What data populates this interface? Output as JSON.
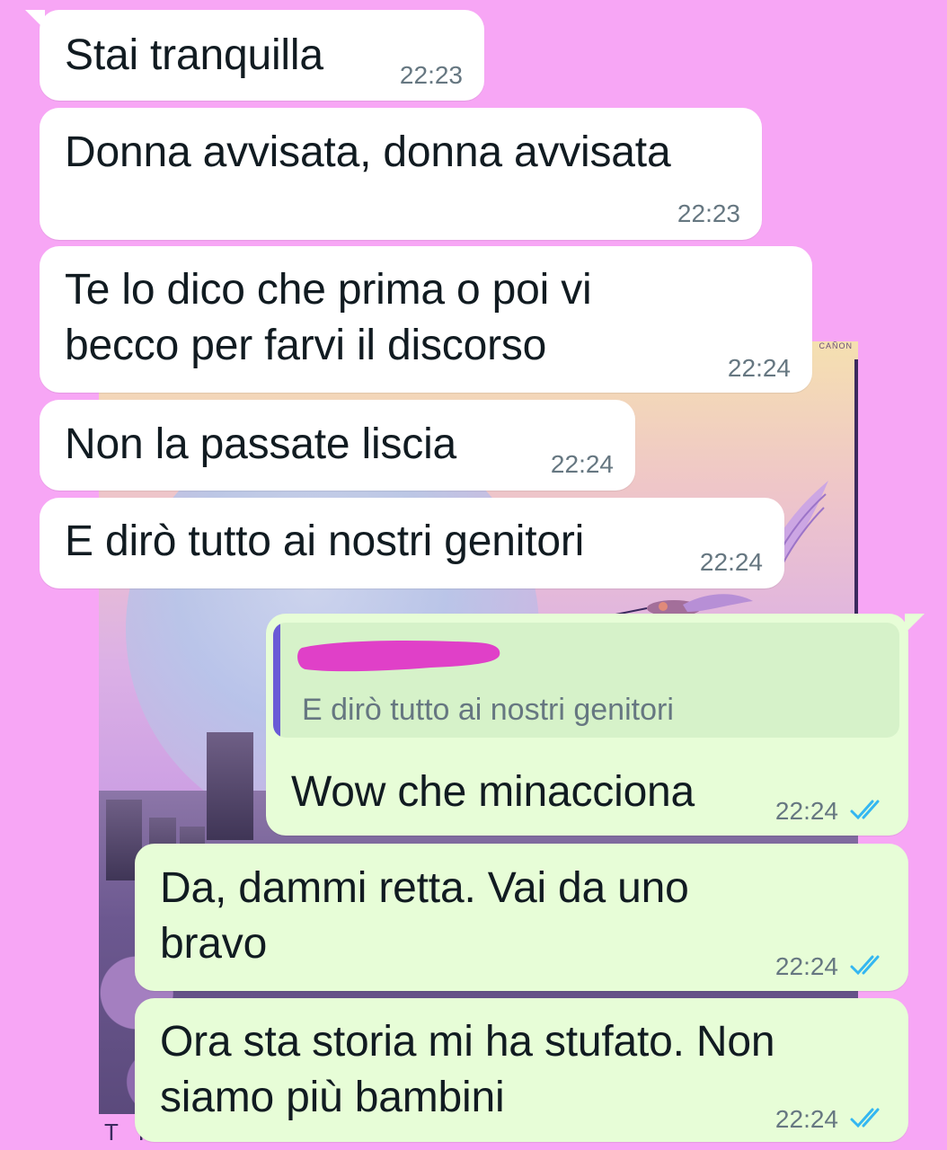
{
  "colors": {
    "background": "#f7a6f5",
    "incoming_bubble": "#ffffff",
    "outgoing_bubble": "#e7fdd7",
    "timestamp": "#667781",
    "read_ticks": "#34b7f1",
    "quote_bar": "#6a5ad6",
    "redaction": "#e040c8"
  },
  "wallpaper": {
    "brand": "CAÑON",
    "caption": "THE END OF THE PROMISED LANDS"
  },
  "messages": [
    {
      "direction": "incoming",
      "text": "Stai tranquilla",
      "time": "22:23"
    },
    {
      "direction": "incoming",
      "text": "Donna avvisata, donna avvisata",
      "time": "22:23"
    },
    {
      "direction": "incoming",
      "text": "Te lo dico che prima o poi vi\nbecco per farvi il discorso",
      "time": "22:24"
    },
    {
      "direction": "incoming",
      "text": "Non la passate liscia",
      "time": "22:24"
    },
    {
      "direction": "incoming",
      "text": "E dirò tutto ai nostri genitori",
      "time": "22:24"
    },
    {
      "direction": "outgoing",
      "text": "Wow che minacciona",
      "time": "22:24",
      "status_icon": "double-check-read-icon",
      "reply_to": {
        "author": "",
        "author_redacted": true,
        "text": "E dirò tutto ai nostri genitori"
      }
    },
    {
      "direction": "outgoing",
      "text": "Da, dammi retta. Vai da uno\nbravo",
      "time": "22:24",
      "status_icon": "double-check-read-icon"
    },
    {
      "direction": "outgoing",
      "text": "Ora sta storia mi ha stufato. Non\nsiamo più bambini",
      "time": "22:24",
      "status_icon": "double-check-read-icon"
    }
  ]
}
